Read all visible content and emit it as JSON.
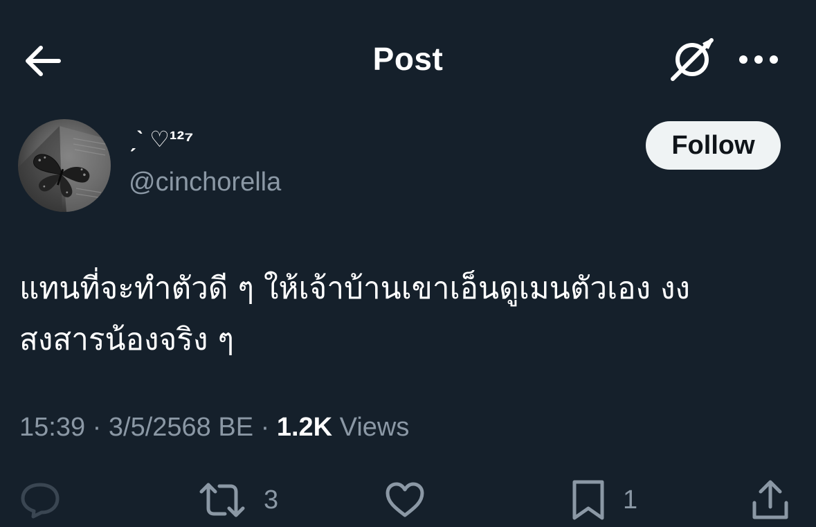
{
  "header": {
    "title": "Post"
  },
  "author": {
    "display_name": "ˏˋ ♡¹²⁷",
    "handle": "@cinchorella",
    "follow_label": "Follow"
  },
  "post": {
    "text_lines": [
      "แทนที่จะทำตัวดี ๆ ให้เจ้าบ้านเขาเอ็นดูเมนตัวเอง งง",
      "สงสารน้องจริง ๆ"
    ],
    "time": "15:39",
    "date": "3/5/2568 BE",
    "views_count": "1.2K",
    "views_label": "Views"
  },
  "actions": {
    "reply_count": "",
    "repost_count": "3",
    "like_count": "",
    "bookmark_count": "1"
  },
  "icons": {
    "back": "arrow-left-icon",
    "grok": "grok-icon",
    "more": "more-horizontal-icon",
    "reply": "reply-icon",
    "repost": "repost-icon",
    "like": "heart-icon",
    "bookmark": "bookmark-icon",
    "share": "share-icon"
  },
  "colors": {
    "background": "#15202b",
    "primary_text": "#ffffff",
    "secondary_text": "#8b98a5",
    "follow_bg": "#eff3f4",
    "reply_icon_dim": "#3a4652"
  }
}
